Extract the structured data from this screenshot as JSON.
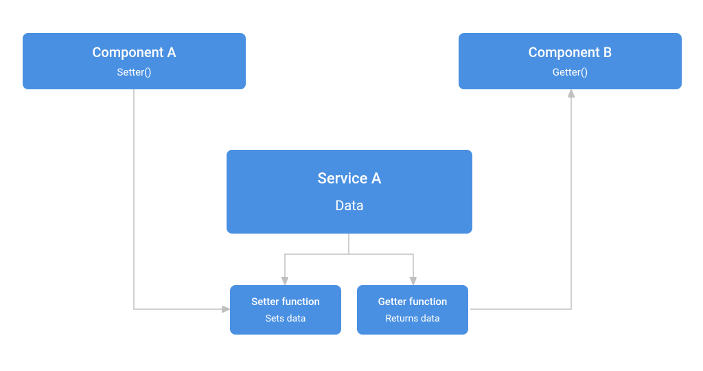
{
  "boxes": {
    "componentA": {
      "title": "Component A",
      "subtitle": "Setter()"
    },
    "componentB": {
      "title": "Component B",
      "subtitle": "Getter()"
    },
    "serviceA": {
      "title": "Service A",
      "subtitle": "Data"
    },
    "setterFn": {
      "title": "Setter function",
      "subtitle": "Sets data"
    },
    "getterFn": {
      "title": "Getter function",
      "subtitle": "Returns data"
    }
  },
  "colors": {
    "box": "#4A90E2",
    "arrow": "#C0C0C0"
  }
}
